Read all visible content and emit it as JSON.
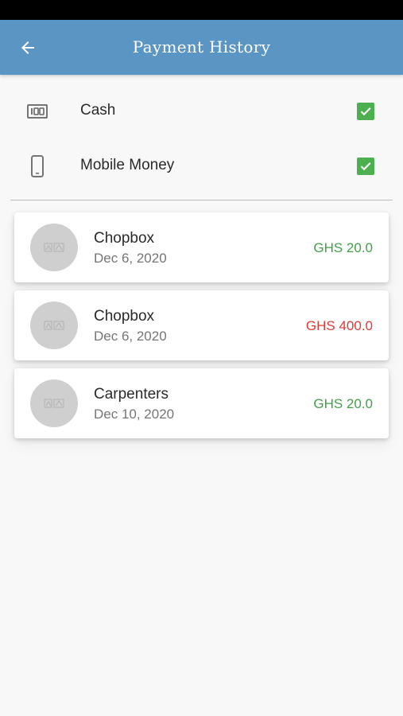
{
  "header": {
    "title": "Payment History"
  },
  "filters": [
    {
      "label": "Cash",
      "icon": "cash-icon",
      "checked": true
    },
    {
      "label": "Mobile Money",
      "icon": "phone-icon",
      "checked": true
    }
  ],
  "transactions": [
    {
      "name": "Chopbox",
      "date": "Dec 6, 2020",
      "amount": "GHS 20.0",
      "color": "#43a047"
    },
    {
      "name": "Chopbox",
      "date": "Dec 6, 2020",
      "amount": "GHS 400.0",
      "color": "#e53935"
    },
    {
      "name": "Carpenters",
      "date": "Dec 10, 2020",
      "amount": "GHS 20.0",
      "color": "#43a047"
    }
  ],
  "colors": {
    "app_bar": "#5b95c4",
    "checkbox": "#4caf50",
    "income": "#43a047",
    "expense": "#e53935"
  }
}
